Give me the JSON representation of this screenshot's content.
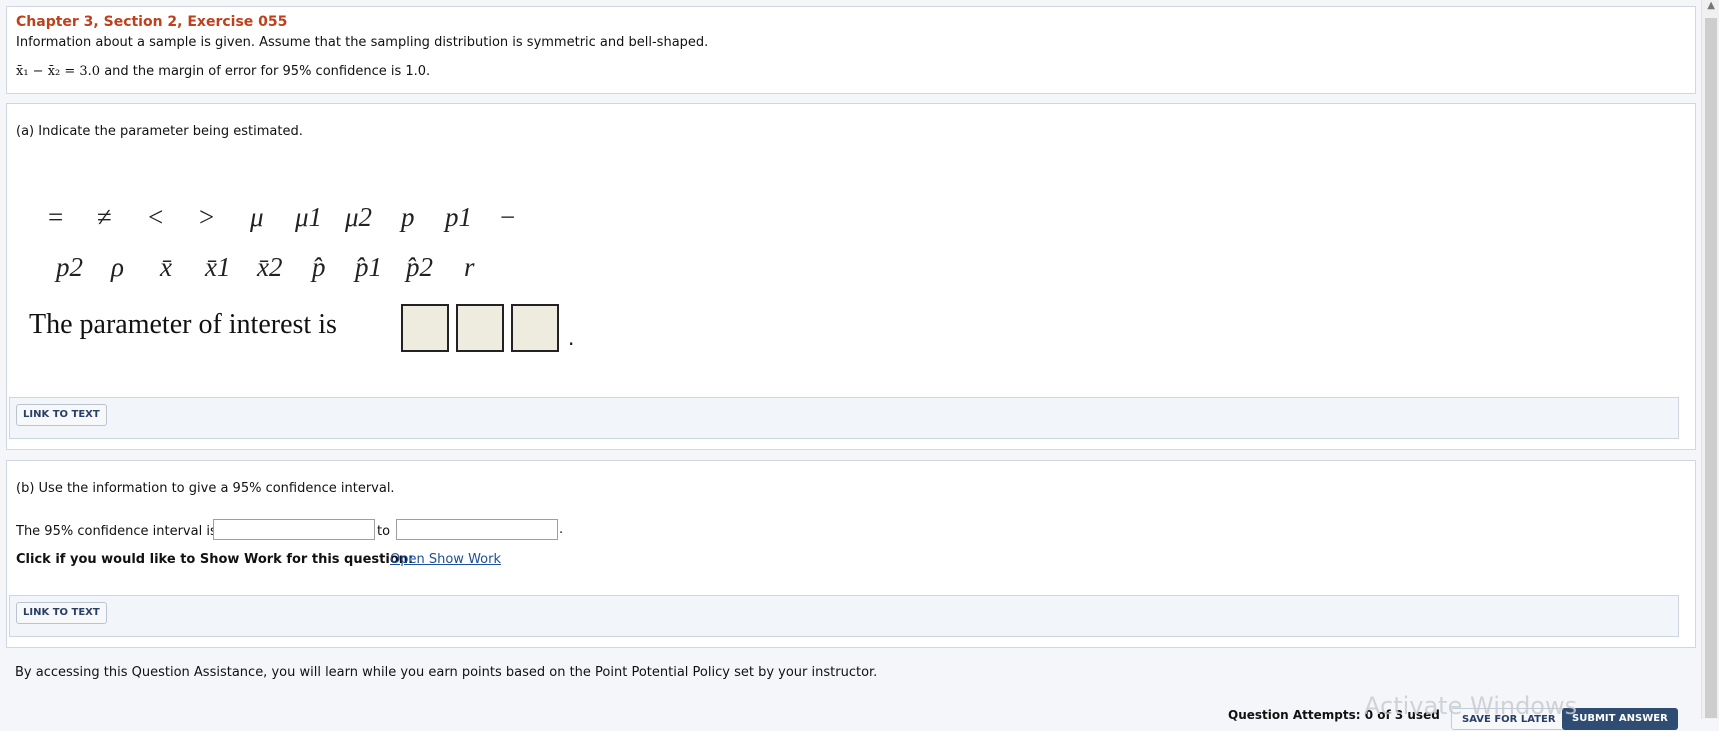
{
  "header": {
    "title": "Chapter 3, Section 2, Exercise 055",
    "description": "Information about a sample is given. Assume that the sampling distribution is symmetric and bell-shaped.",
    "given_expr": "x̄₁ − x̄₂ = 3.0",
    "given_text": "and the margin of error for 95% confidence is 1.0."
  },
  "part_a": {
    "question": "(a) Indicate the parameter being estimated.",
    "palette_row1": [
      "=",
      "≠",
      "<",
      ">",
      "μ",
      "μ1",
      "μ2",
      "p",
      "p1",
      "−"
    ],
    "palette_row2": [
      "p2",
      "ρ",
      "x̄",
      "x̄1",
      "x̄2",
      "p̂",
      "p̂1",
      "p̂2",
      "r"
    ],
    "prompt": "The parameter of interest is",
    "period": ".",
    "link_label": "LINK TO TEXT"
  },
  "part_b": {
    "question": "(b) Use the information to give a 95% confidence interval.",
    "interval_prefix": "The 95% confidence interval is",
    "interval_mid": "to",
    "interval_end": ".",
    "lower_value": "",
    "upper_value": "",
    "show_work_prompt": "Click if you would like to Show Work for this question:",
    "show_work_link": "Open Show Work",
    "link_label": "LINK TO TEXT"
  },
  "footer": {
    "assistance_text": "By accessing this Question Assistance, you will learn while you earn points based on the Point Potential Policy set by your instructor.",
    "attempts": "Question Attempts: 0 of 3 used",
    "save_label": "SAVE FOR LATER",
    "submit_label": "SUBMIT ANSWER",
    "watermark": "Activate Windows"
  },
  "colors": {
    "heading": "#c0401c",
    "link": "#1d4fa0",
    "submit_bg": "#2f4d73",
    "answer_box": "#eeebdf"
  }
}
